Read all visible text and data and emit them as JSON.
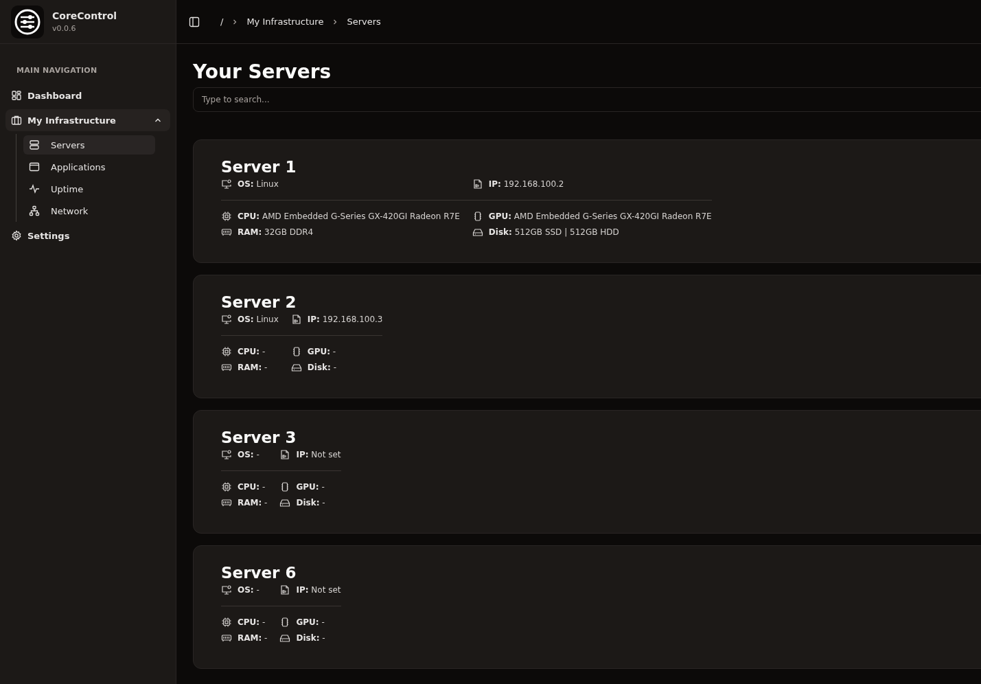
{
  "sidebar": {
    "app_name": "CoreControl",
    "version": "v0.0.6",
    "section_label": "MAIN NAVIGATION",
    "items": [
      {
        "label": "Dashboard",
        "selected": false
      },
      {
        "label": "My Infrastructure",
        "selected": false,
        "expanded": true,
        "children": [
          {
            "label": "Servers",
            "selected": true
          },
          {
            "label": "Applications",
            "selected": false
          },
          {
            "label": "Uptime",
            "selected": false
          },
          {
            "label": "Network",
            "selected": false
          }
        ]
      },
      {
        "label": "Settings",
        "selected": false
      }
    ]
  },
  "breadcrumb": [
    "/",
    "My Infrastructure",
    "Servers"
  ],
  "page_title": "Your Servers",
  "search": {
    "placeholder": "Type to search..."
  },
  "servers": [
    {
      "name": "Server 1",
      "os": "**OS:** Linux",
      "ip": "**IP:** 192.168.100.2",
      "cpu": "**CPU:** AMD Embedded G-Series GX-420GI Radeon R7E",
      "gpu": "**GPU:** AMD Embedded G-Series GX-420GI Radeon R7E",
      "ram": "**RAM:** 32GB DDR4",
      "disk": "**Disk:** 512GB SSD | 512GB HDD"
    },
    {
      "name": "Server 2",
      "os": "**OS:** Linux",
      "ip": "**IP:** 192.168.100.3",
      "cpu": "**CPU:** -",
      "gpu": "**GPU:** -",
      "ram": "**RAM:** -",
      "disk": "**Disk:** -"
    },
    {
      "name": "Server 3",
      "os": "**OS:** -",
      "ip": "**IP:** Not set",
      "cpu": "**CPU:** -",
      "gpu": "**GPU:** -",
      "ram": "**RAM:** -",
      "disk": "**Disk:** -"
    },
    {
      "name": "Server 6",
      "os": "**OS:** -",
      "ip": "**IP:** Not set",
      "cpu": "**CPU:** -",
      "gpu": "**GPU:** -",
      "ram": "**RAM:** -",
      "disk": "**Disk:** -"
    }
  ]
}
